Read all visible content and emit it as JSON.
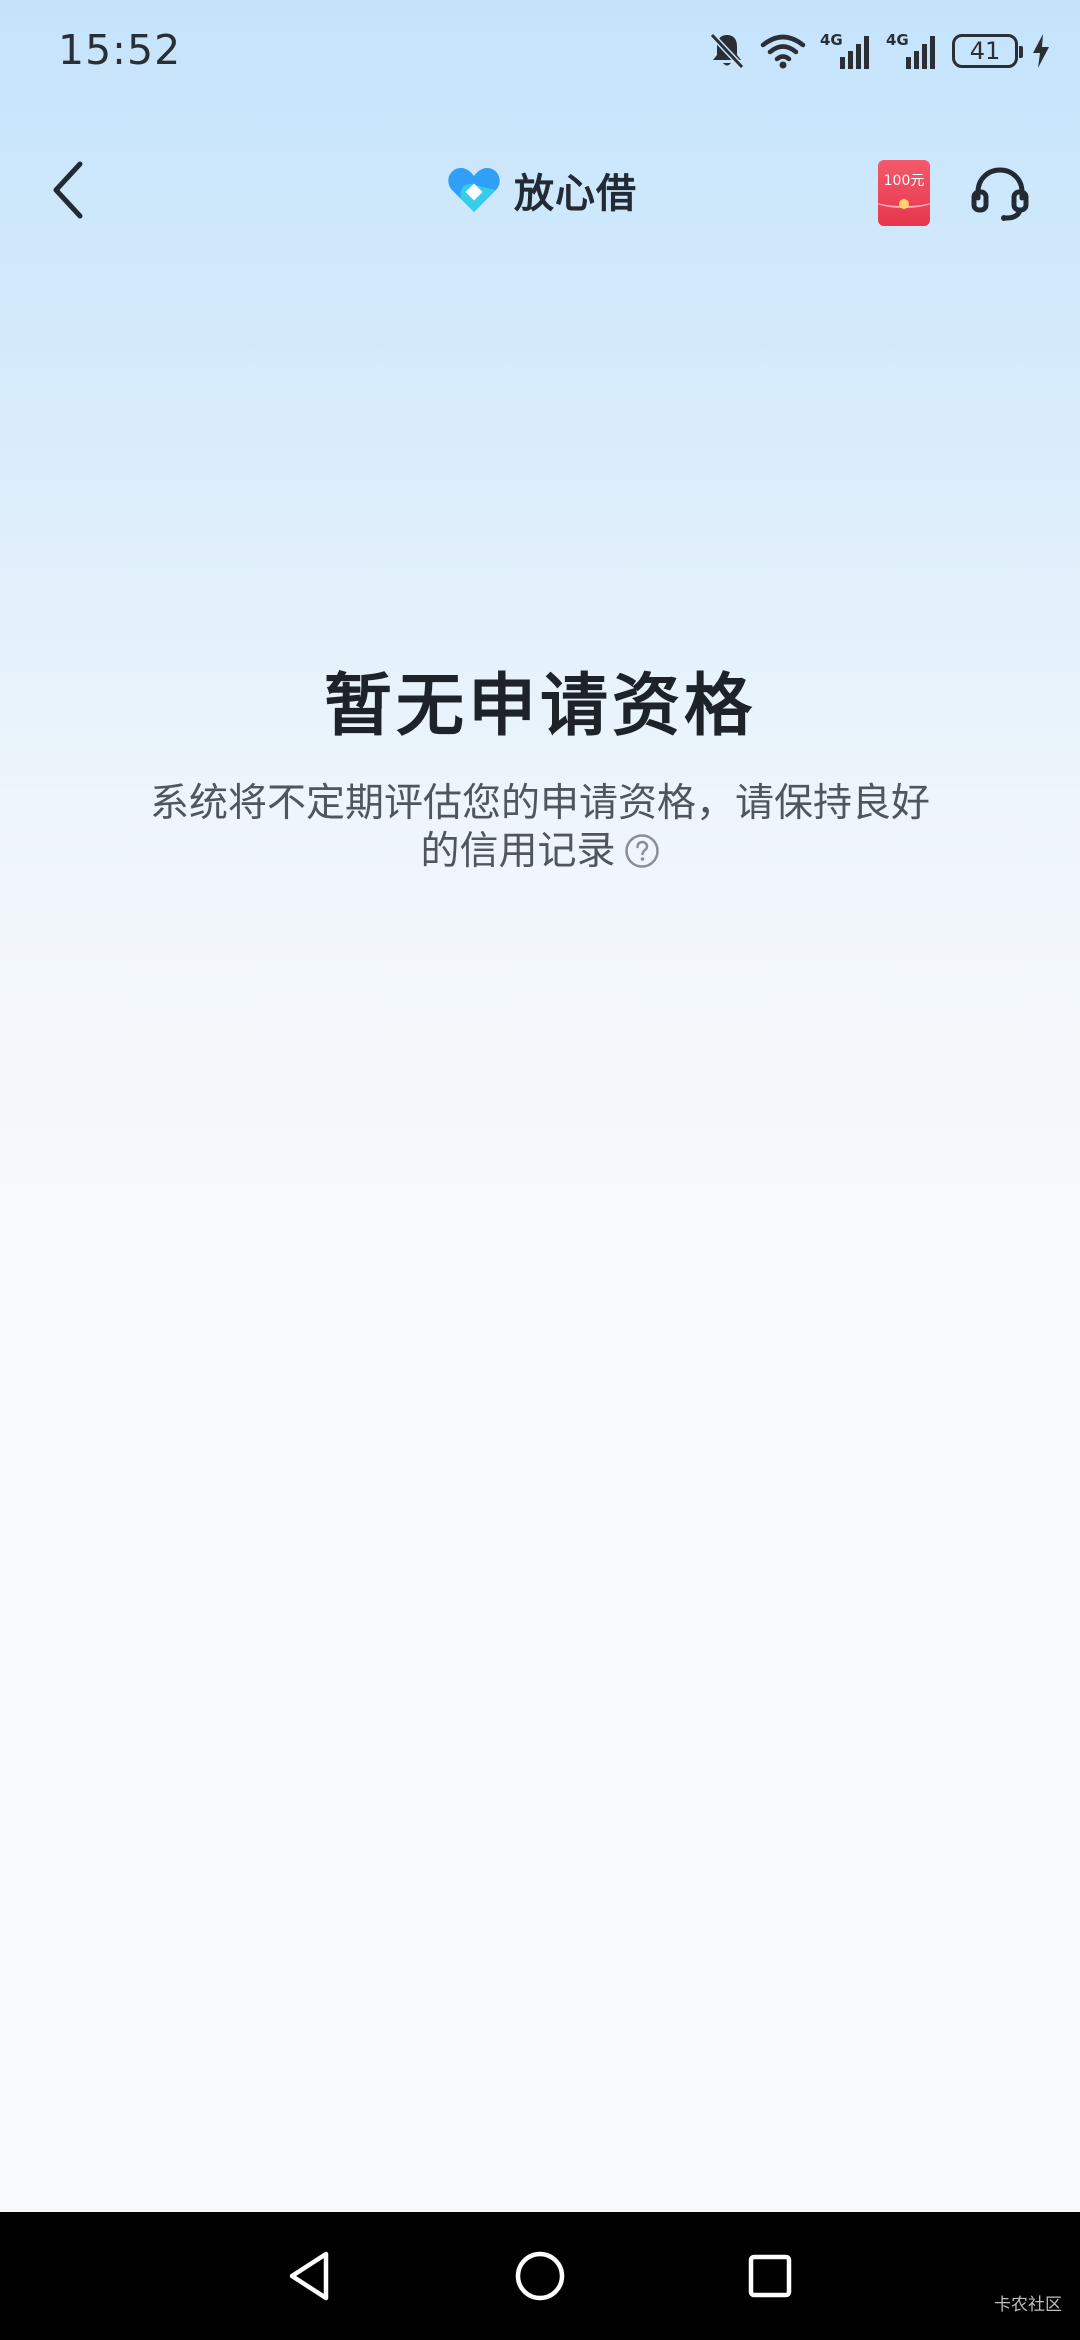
{
  "status_bar": {
    "time": "15:52",
    "network_1": "4G",
    "network_2": "4G",
    "battery_level": "41",
    "icons": [
      "bell-muted-icon",
      "wifi-icon",
      "signal-icon",
      "signal-icon",
      "battery-icon",
      "charging-icon"
    ]
  },
  "header": {
    "brand_name": "放心借",
    "redpacket_label": "100元",
    "icons": [
      "back-arrow-icon",
      "brand-logo-icon",
      "redpacket-icon",
      "headset-support-icon"
    ]
  },
  "main": {
    "title": "暂无申请资格",
    "description": "系统将不定期评估您的申请资格，请保持良好的信用记录",
    "help_icon": "question-circle-icon"
  },
  "nav_bar": {
    "icons": [
      "nav-back-triangle-icon",
      "nav-home-circle-icon",
      "nav-recent-square-icon"
    ],
    "watermark": "卡农社区"
  },
  "colors": {
    "background_top": "#c4e3fb",
    "background_bottom": "#f8f9fa",
    "title": "#1e2329",
    "description": "#4f565e",
    "brand_blue": "#2f9ff7",
    "brand_cyan": "#37d3e8",
    "redpacket": "#e8364d",
    "nav_bar": "#000000"
  }
}
